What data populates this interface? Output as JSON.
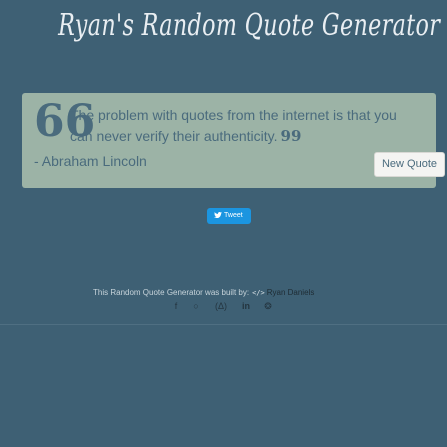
{
  "header": {
    "title": "Ryan's Random Quote Generator"
  },
  "quote": {
    "text": "The problem with quotes from the internet is that you can never verify their authenticity.",
    "open_mark": "66",
    "close_mark": "99",
    "author": "- Abraham Lincoln"
  },
  "actions": {
    "new_quote_label": "New Quote",
    "tweet_label": "Tweet"
  },
  "footer": {
    "built_by_text": "This Random Quote Generator was built by:",
    "code_symbol": "</>",
    "author_name": "Ryan Daniels"
  },
  "social": [
    {
      "icon": "facebook-icon",
      "glyph": "f"
    },
    {
      "icon": "github-icon",
      "glyph": "○"
    },
    {
      "icon": "freecodecamp-icon",
      "glyph": "(Δ)"
    },
    {
      "icon": "linkedin-icon",
      "glyph": "in"
    },
    {
      "icon": "codepen-icon",
      "glyph": "❂"
    }
  ],
  "colors": {
    "background": "#3e6074",
    "card": "#9cb3a6",
    "accent": "#4a6b7d",
    "tweet": "#1b95e0"
  }
}
